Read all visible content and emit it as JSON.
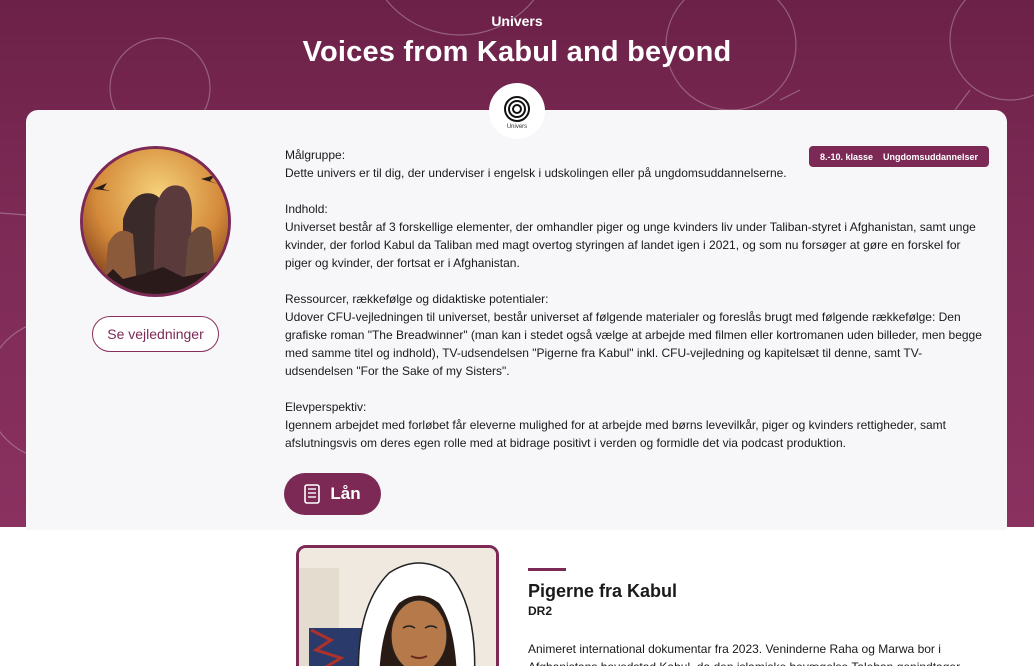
{
  "header": {
    "eyebrow": "Univers",
    "title": "Voices from Kabul and beyond",
    "logo_caption": "Univers"
  },
  "colors": {
    "brand": "#7c2a55",
    "hero_bg": "#6c2148",
    "card_bg": "#f7f7fa"
  },
  "sidebar": {
    "guides_button": "Se vejledninger"
  },
  "tags": [
    "8.-10. klasse",
    "Ungdomsuddannelser"
  ],
  "content": {
    "target_heading": "Målgruppe:",
    "target_text": "Dette univers er til dig, der underviser i engelsk i udskolingen eller på ungdomsuddannelserne.",
    "content_heading": "Indhold:",
    "content_text": "Universet består af 3 forskellige elementer, der omhandler piger og unge kvinders liv under Taliban-styret i Afghanistan, samt unge kvinder, der forlod Kabul da Taliban med magt overtog styringen af landet igen i 2021, og som nu forsøger at gøre en forskel for piger og kvinder, der fortsat er i Afghanistan.",
    "resources_heading": "Ressourcer, rækkefølge og didaktiske potentialer:",
    "resources_text": "Udover CFU-vejledningen til universet, består universet af følgende materialer og foreslås brugt med følgende rækkefølge: Den grafiske roman \"The Breadwinner\" (man kan i stedet også vælge at arbejde med filmen eller kortromanen uden billeder, men begge med samme titel og indhold), TV-udsendelsen \"Pigerne fra Kabul\" inkl. CFU-vejledning og kapitelsæt til denne, samt TV-udsendelsen \"For the Sake of my Sisters\".",
    "student_heading": "Elevperspektiv:",
    "student_text": "Igennem arbejdet med forløbet får eleverne mulighed for at arbejde med børns levevilkår, piger og kvinders rettigheder, samt afslutningsvis om deres egen rolle med at bidrage positivt i verden og formidle det via podcast produktion."
  },
  "loan_button": {
    "label": "Lån",
    "icon": "book-icon"
  },
  "item": {
    "title": "Pigerne fra Kabul",
    "channel": "DR2",
    "description": "Animeret international dokumentar fra 2023. Veninderne Raha og Marwa bor i Afghanistans hovedstad Kabul, da den islamiske bevægelse Taleban genindtager"
  }
}
